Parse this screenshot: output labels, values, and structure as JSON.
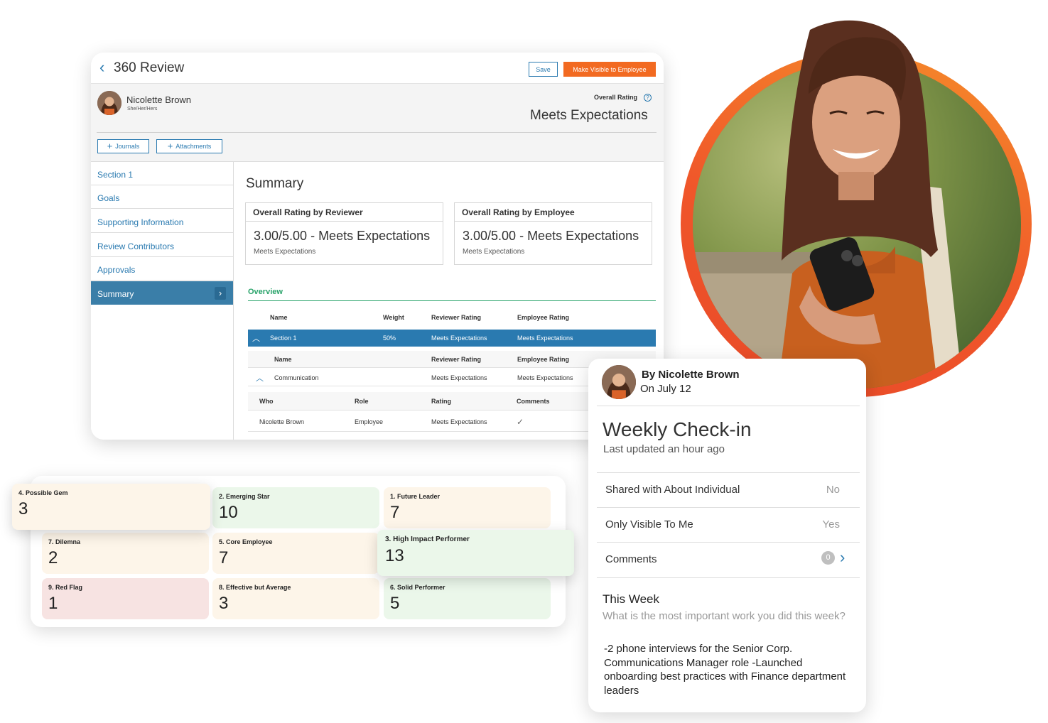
{
  "review": {
    "title": "360 Review",
    "save_label": "Save",
    "visible_label": "Make Visible to Employee",
    "employee_name": "Nicolette Brown",
    "employee_pronouns": "She/Her/Hers",
    "overall_rating_label": "Overall Rating",
    "overall_rating_value": "Meets Expectations",
    "chips": [
      "Journals",
      "Attachments"
    ],
    "nav": [
      "Section 1",
      "Goals",
      "Supporting Information",
      "Review Contributors",
      "Approvals",
      "Summary"
    ],
    "summary_title": "Summary",
    "reviewer_box": {
      "header": "Overall Rating by Reviewer",
      "value": "3.00/5.00 - Meets Expectations",
      "sub": "Meets Expectations"
    },
    "employee_box": {
      "header": "Overall Rating by Employee",
      "value": "3.00/5.00 - Meets Expectations",
      "sub": "Meets Expectations"
    },
    "overview_tab": "Overview",
    "table": {
      "headers": [
        "Name",
        "Weight",
        "Reviewer Rating",
        "Employee Rating"
      ],
      "section_row": [
        "Section 1",
        "50%",
        "Meets Expectations",
        "Meets Expectations"
      ],
      "sub_headers": [
        "Name",
        "Reviewer Rating",
        "Employee Rating"
      ],
      "sub_row": [
        "Communication",
        "Meets Expectations",
        "Meets Expectations"
      ],
      "detail_headers": [
        "Who",
        "Role",
        "Rating",
        "Comments"
      ],
      "detail_row": [
        "Nicolette Brown",
        "Employee",
        "Meets Expectations"
      ],
      "check_glyph": "✓"
    }
  },
  "grid": [
    {
      "label": "4. Possible Gem",
      "count": "3"
    },
    {
      "label": "2. Emerging Star",
      "count": "10"
    },
    {
      "label": "1. Future Leader",
      "count": "7"
    },
    {
      "label": "7. Dilemna",
      "count": "2"
    },
    {
      "label": "5. Core Employee",
      "count": "7"
    },
    {
      "label": "3. High Impact Performer",
      "count": "13"
    },
    {
      "label": "9. Red Flag",
      "count": "1"
    },
    {
      "label": "8. Effective but Average",
      "count": "3"
    },
    {
      "label": "6. Solid Performer",
      "count": "5"
    }
  ],
  "checkin": {
    "by": "By Nicolette Brown",
    "date": "On July 12",
    "title": "Weekly Check-in",
    "updated": "Last updated an hour ago",
    "rows": [
      {
        "label": "Shared with About Individual",
        "value": "No"
      },
      {
        "label": "Only Visible To Me",
        "value": "Yes"
      },
      {
        "label": "Comments",
        "value": "0"
      }
    ],
    "this_week_title": "This Week",
    "question": "What is the most important work you did this week?",
    "answer": "-2 phone interviews for the Senior Corp. Communications Manager role -Launched onboarding best practices with Finance department leaders"
  },
  "colors": {
    "accent": "#2a7ab0",
    "orange": "#f26a21",
    "green": "#29a36a"
  }
}
